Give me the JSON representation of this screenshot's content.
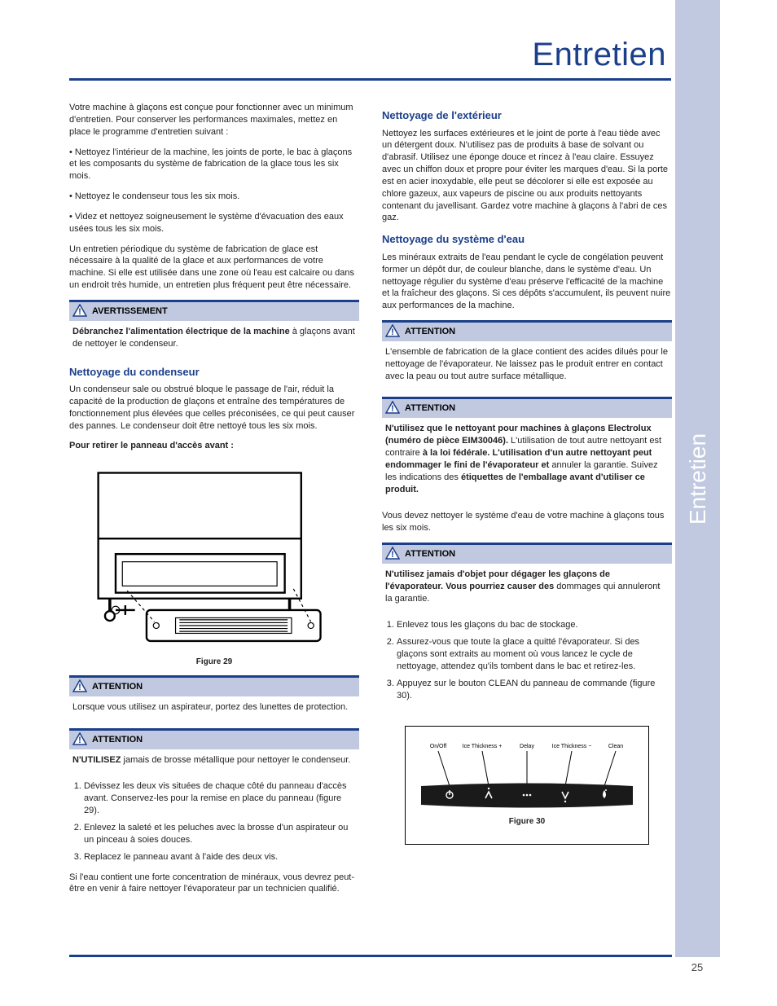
{
  "sidebar_label": "Entretien",
  "page_number": "25",
  "title": "Entretien",
  "intro": {
    "p1": "Votre machine à glaçons est conçue pour fonctionner avec un minimum d'entretien. Pour conserver les performances maximales, mettez en place le programme d'entretien suivant :",
    "b1": "• Nettoyez l'intérieur de la machine, les joints de porte, le bac à glaçons et les composants du système de fabrication de la glace tous les six mois.",
    "b2": "• Nettoyez le condenseur tous les six mois.",
    "b3": "• Videz et nettoyez soigneusement le système d'évacuation des eaux usées tous les six mois.",
    "p2": "Un entretien périodique du système de fabrication de glace est nécessaire à la qualité de la glace et aux performances de votre machine. Si elle est utilisée dans une zone où l'eau est calcaire ou dans un endroit très humide, un entretien plus fréquent peut être nécessaire."
  },
  "callouts": {
    "avert1": {
      "label": "AVERTISSEMENT",
      "body_strong": "Débranchez l'alimentation électrique de la machine",
      "body_rest": " à glaçons avant de nettoyer le condenseur."
    },
    "attn1": {
      "label": "ATTENTION",
      "body": "Lorsque vous utilisez un aspirateur, portez des lunettes de protection."
    },
    "attn2": {
      "label": "ATTENTION",
      "body_pre": "",
      "body_strong": "N'UTILISEZ",
      "body_post": " jamais de brosse métallique pour nettoyer le condenseur."
    },
    "attn3": {
      "label": "ATTENTION",
      "body": "L'ensemble de fabrication de la glace contient des acides dilués pour le nettoyage de l'évaporateur. Ne laissez pas le produit entrer en contact avec la peau ou tout autre surface métallique."
    },
    "attn4": {
      "label": "ATTENTION",
      "l1_strong": "N'utilisez que le nettoyant pour machines à glaçons Electrolux (numéro de pièce EIM30046).",
      "l1_rest": " L'utilisation de tout autre nettoyant est contraire ",
      "l2_strong": "à la loi fédérale. L'utilisation d'un autre nettoyant peut endommager le fini de l'évaporateur et",
      "l2_rest": " annuler la garantie. Suivez les indications des ",
      "l3_strong": "étiquettes de l'emballage avant d'utiliser ce produit."
    },
    "attn5": {
      "label": "ATTENTION",
      "body_strong": "N'utilisez jamais d'objet pour dégager les glaçons de l'évaporateur. Vous pourriez causer des",
      "body_rest": " dommages qui annuleront la garantie."
    }
  },
  "left": {
    "cond_h": "Nettoyage du condenseur",
    "cond_p": "Un condenseur sale ou obstrué bloque le passage de l'air, réduit la capacité de la production de glaçons et entraîne des températures de fonctionnement plus élevées que celles préconisées, ce qui peut causer des pannes. Le condenseur doit être nettoyé tous les six mois.",
    "fig29_caption": "Figure 29",
    "steps_title": "Pour retirer le panneau d'accès avant :",
    "s1": "Dévissez les deux vis situées de chaque côté du panneau d'accès avant. Conservez-les pour la remise en place du panneau (figure 29).",
    "s2": "Enlevez la saleté et les peluches avec la brosse d'un aspirateur ou un pinceau à soies douces.",
    "s3": "Replacez le panneau avant à l'aide des deux vis."
  },
  "right": {
    "p0": "Si l'eau contient une forte concentration de minéraux, vous devrez peut-être en venir à faire nettoyer l'évaporateur par un technicien qualifié.",
    "ext_h": "Nettoyage de l'extérieur",
    "ext_p": "Nettoyez les surfaces extérieures et le joint de porte à l'eau tiède avec un détergent doux. N'utilisez pas de produits à base de solvant ou d'abrasif. Utilisez une éponge douce et rincez à l'eau claire. Essuyez avec un chiffon doux et propre pour éviter les marques d'eau. Si la porte est en acier inoxydable, elle peut se décolorer si elle est exposée au chlore gazeux, aux vapeurs de piscine ou aux produits nettoyants contenant du javellisant. Gardez votre machine à glaçons à l'abri de ces gaz.",
    "sys_h": "Nettoyage du système d'eau",
    "sys_p1": "Les minéraux extraits de l'eau pendant le cycle de congélation peuvent former un dépôt dur, de couleur blanche, dans le système d'eau. Un nettoyage régulier du système d'eau préserve l'efficacité de la machine et la fraîcheur des glaçons. Si ces dépôts s'accumulent, ils peuvent nuire aux performances de la machine.",
    "sys_p2": "Vous devez nettoyer le système d'eau de votre machine à glaçons tous les six mois.",
    "steps1": "Enlevez tous les glaçons du bac de stockage.",
    "steps2": "Assurez-vous que toute la glace a quitté l'évaporateur. Si des glaçons sont extraits au moment où vous lancez le cycle de nettoyage, attendez qu'ils tombent dans le bac et retirez-les.",
    "steps3": "Appuyez sur le bouton CLEAN du panneau de commande (figure 30).",
    "fig30_caption": "Figure 30",
    "panel_labels": [
      "On/Off",
      "Ice Thickness +",
      "Delay",
      "Ice Thickness −",
      "Clean"
    ]
  }
}
